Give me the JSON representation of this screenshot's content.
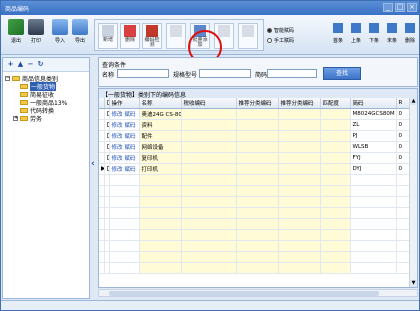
{
  "window": {
    "title": "商品编码"
  },
  "toolbar": {
    "buttons": [
      {
        "label": "退出",
        "icon": "exit-icon"
      },
      {
        "label": "打印",
        "icon": "printer-icon"
      },
      {
        "label": "导入",
        "icon": "import-icon"
      },
      {
        "label": "导出",
        "icon": "export-icon"
      }
    ],
    "group": [
      {
        "label": "新增",
        "icon": "add-icon"
      },
      {
        "label": "删除",
        "icon": "delete-icon"
      },
      {
        "label": "编码检测",
        "icon": "code-check-icon"
      },
      {
        "label": "",
        "icon": "disabled-icon"
      },
      {
        "label": "批量添加",
        "icon": "batch-add-icon"
      },
      {
        "label": "",
        "icon": "disabled-icon"
      },
      {
        "label": "",
        "icon": "disabled-icon"
      }
    ],
    "radio_auto": "智能赋码",
    "radio_manual": "手工赋码",
    "nav": [
      "首条",
      "上条",
      "下条",
      "末条",
      "删除"
    ]
  },
  "tree": {
    "nodes": [
      {
        "label": "商品信息类别",
        "level": 0,
        "toggle": "-",
        "selected": false
      },
      {
        "label": "一般货物",
        "level": 1,
        "toggle": "",
        "selected": true
      },
      {
        "label": "简易征收",
        "level": 1,
        "toggle": "",
        "selected": false
      },
      {
        "label": "一般商品13%",
        "level": 1,
        "toggle": "",
        "selected": false
      },
      {
        "label": "代码转换",
        "level": 1,
        "toggle": "",
        "selected": false
      },
      {
        "label": "劳务",
        "level": 1,
        "toggle": "+",
        "selected": false
      }
    ]
  },
  "query": {
    "title": "查询条件",
    "name_label": "名称",
    "spec_label": "规格型号",
    "abbr_label": "简码",
    "search_button": "查找"
  },
  "grid": {
    "title": "【一般货物】类别下的编码信息",
    "columns": [
      "操作",
      "名称",
      "税收编码",
      "推荐分类编码",
      "推荐分类编码",
      "匹配度",
      "简码",
      "R"
    ],
    "op_edit": "修改",
    "op_assign": "赋码",
    "rows": [
      {
        "name": "奥迪24G CS-80M",
        "abbr": "M8024GCS80M",
        "r": "0"
      },
      {
        "name": "资料",
        "abbr": "ZL",
        "r": "0"
      },
      {
        "name": "配件",
        "abbr": "PJ",
        "r": "0"
      },
      {
        "name": "网络设备",
        "abbr": "WLSB",
        "r": "0"
      },
      {
        "name": "复印机",
        "abbr": "FYJ",
        "r": "0"
      },
      {
        "name": "打印机",
        "abbr": "DYJ",
        "r": "0"
      }
    ]
  }
}
